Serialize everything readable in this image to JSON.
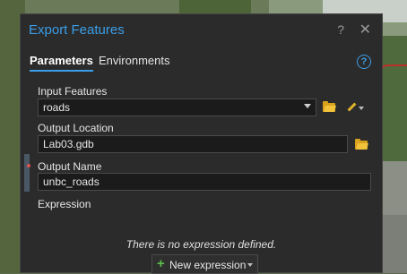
{
  "dialog": {
    "title": "Export Features",
    "help_symbol": "?",
    "close_symbol": "✕"
  },
  "tabs": [
    {
      "label": "Parameters",
      "active": true
    },
    {
      "label": "Environments",
      "active": false
    }
  ],
  "help_circle": "?",
  "fields": {
    "input_features": {
      "label": "Input Features",
      "value": "roads",
      "icon": "folder-icon",
      "extra_icon": "pencil-icon"
    },
    "output_location": {
      "label": "Output Location",
      "value": "Lab03.gdb",
      "icon": "folder-icon"
    },
    "output_name": {
      "label": "Output Name",
      "value": "unbc_roads",
      "required": true
    }
  },
  "expression": {
    "label": "Expression",
    "empty_message": "There is no expression defined.",
    "new_button_label": "New expression"
  },
  "colors": {
    "accent": "#3b9ee8",
    "panel_bg": "#2b2b2b",
    "folder": "#f2c23a",
    "required": "#e05050",
    "add": "#5bbf4a"
  }
}
